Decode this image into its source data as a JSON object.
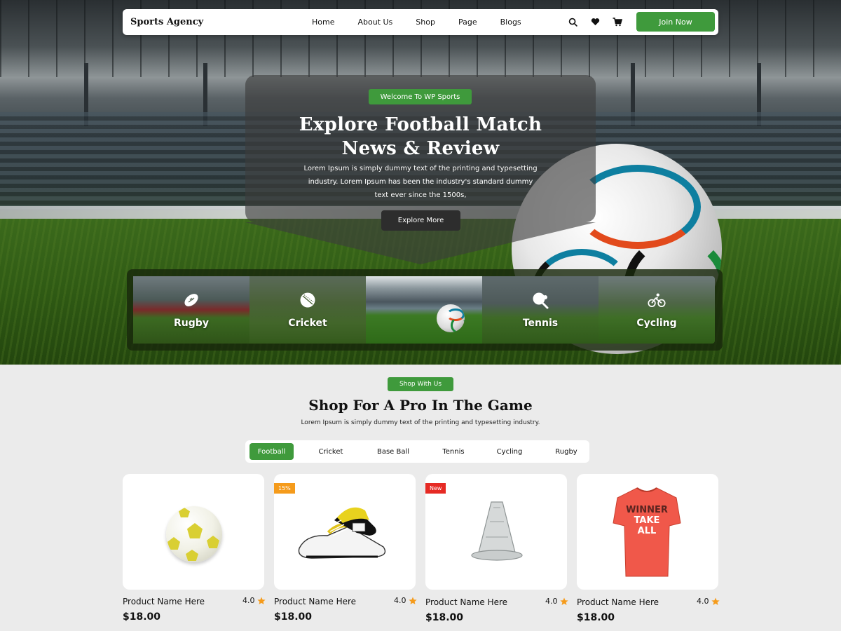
{
  "brand": "Sports Agency",
  "nav": {
    "items": [
      "Home",
      "About Us",
      "Shop",
      "Page",
      "Blogs"
    ],
    "join_label": "Join Now"
  },
  "hero": {
    "badge": "Welcome To WP Sports",
    "title_line1": "Explore Football Match",
    "title_line2": "News & Review",
    "text": "Lorem Ipsum is simply dummy text of the printing and typesetting industry. Lorem Ipsum has been the industry's standard dummy text ever since the 1500s,",
    "button": "Explore More"
  },
  "categories": [
    {
      "label": "Rugby",
      "icon": "rugby-ball-icon"
    },
    {
      "label": "Cricket",
      "icon": "cricket-ball-icon"
    },
    {
      "label": "",
      "icon": "football-image"
    },
    {
      "label": "Tennis",
      "icon": "tennis-icon"
    },
    {
      "label": "Cycling",
      "icon": "cycling-icon"
    }
  ],
  "shop": {
    "badge": "Shop With Us",
    "title": "Shop For A Pro In The Game",
    "subtitle": "Lorem Ipsum is simply dummy text of the printing and typesetting industry.",
    "tabs": [
      "Football",
      "Cricket",
      "Base Ball",
      "Tennis",
      "Cycling",
      "Rugby"
    ],
    "active_tab": "Football"
  },
  "products": [
    {
      "name": "Product Name Here",
      "rating": "4.0",
      "price": "$18.00",
      "badge": "",
      "image": "football-product"
    },
    {
      "name": "Product Name Here",
      "rating": "4.0",
      "price": "$18.00",
      "badge": "15%",
      "badge_color": "#f59b1b",
      "image": "football-boots-product"
    },
    {
      "name": "Product Name Here",
      "rating": "4.0",
      "price": "$18.00",
      "badge": "New",
      "badge_color": "#e62a24",
      "image": "training-cone-product"
    },
    {
      "name": "Product Name Here",
      "rating": "4.0",
      "price": "$18.00",
      "badge": "",
      "image": "t-shirt-product",
      "shirt_text": [
        "WINNER",
        "TAKE",
        "ALL"
      ]
    }
  ],
  "colors": {
    "accent": "#3f9a3c",
    "star": "#f59b1b"
  }
}
